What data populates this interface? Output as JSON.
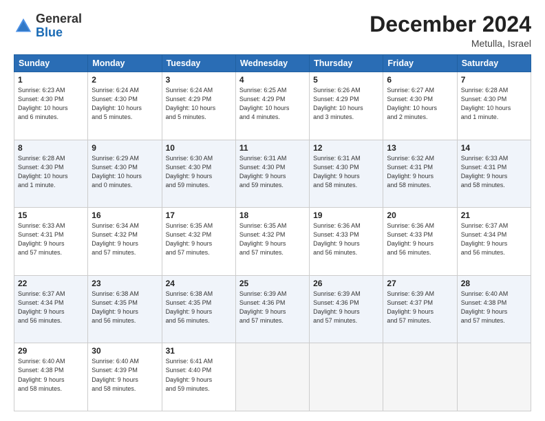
{
  "header": {
    "logo_general": "General",
    "logo_blue": "Blue",
    "month_title": "December 2024",
    "location": "Metulla, Israel"
  },
  "days_of_week": [
    "Sunday",
    "Monday",
    "Tuesday",
    "Wednesday",
    "Thursday",
    "Friday",
    "Saturday"
  ],
  "weeks": [
    [
      {
        "day": 1,
        "sunrise": "6:23 AM",
        "sunset": "4:30 PM",
        "daylight": "10 hours and 6 minutes."
      },
      {
        "day": 2,
        "sunrise": "6:24 AM",
        "sunset": "4:30 PM",
        "daylight": "10 hours and 5 minutes."
      },
      {
        "day": 3,
        "sunrise": "6:24 AM",
        "sunset": "4:29 PM",
        "daylight": "10 hours and 5 minutes."
      },
      {
        "day": 4,
        "sunrise": "6:25 AM",
        "sunset": "4:29 PM",
        "daylight": "10 hours and 4 minutes."
      },
      {
        "day": 5,
        "sunrise": "6:26 AM",
        "sunset": "4:29 PM",
        "daylight": "10 hours and 3 minutes."
      },
      {
        "day": 6,
        "sunrise": "6:27 AM",
        "sunset": "4:30 PM",
        "daylight": "10 hours and 2 minutes."
      },
      {
        "day": 7,
        "sunrise": "6:28 AM",
        "sunset": "4:30 PM",
        "daylight": "10 hours and 1 minute."
      }
    ],
    [
      {
        "day": 8,
        "sunrise": "6:28 AM",
        "sunset": "4:30 PM",
        "daylight": "10 hours and 1 minute."
      },
      {
        "day": 9,
        "sunrise": "6:29 AM",
        "sunset": "4:30 PM",
        "daylight": "10 hours and 0 minutes."
      },
      {
        "day": 10,
        "sunrise": "6:30 AM",
        "sunset": "4:30 PM",
        "daylight": "9 hours and 59 minutes."
      },
      {
        "day": 11,
        "sunrise": "6:31 AM",
        "sunset": "4:30 PM",
        "daylight": "9 hours and 59 minutes."
      },
      {
        "day": 12,
        "sunrise": "6:31 AM",
        "sunset": "4:30 PM",
        "daylight": "9 hours and 58 minutes."
      },
      {
        "day": 13,
        "sunrise": "6:32 AM",
        "sunset": "4:31 PM",
        "daylight": "9 hours and 58 minutes."
      },
      {
        "day": 14,
        "sunrise": "6:33 AM",
        "sunset": "4:31 PM",
        "daylight": "9 hours and 58 minutes."
      }
    ],
    [
      {
        "day": 15,
        "sunrise": "6:33 AM",
        "sunset": "4:31 PM",
        "daylight": "9 hours and 57 minutes."
      },
      {
        "day": 16,
        "sunrise": "6:34 AM",
        "sunset": "4:32 PM",
        "daylight": "9 hours and 57 minutes."
      },
      {
        "day": 17,
        "sunrise": "6:35 AM",
        "sunset": "4:32 PM",
        "daylight": "9 hours and 57 minutes."
      },
      {
        "day": 18,
        "sunrise": "6:35 AM",
        "sunset": "4:32 PM",
        "daylight": "9 hours and 57 minutes."
      },
      {
        "day": 19,
        "sunrise": "6:36 AM",
        "sunset": "4:33 PM",
        "daylight": "9 hours and 56 minutes."
      },
      {
        "day": 20,
        "sunrise": "6:36 AM",
        "sunset": "4:33 PM",
        "daylight": "9 hours and 56 minutes."
      },
      {
        "day": 21,
        "sunrise": "6:37 AM",
        "sunset": "4:34 PM",
        "daylight": "9 hours and 56 minutes."
      }
    ],
    [
      {
        "day": 22,
        "sunrise": "6:37 AM",
        "sunset": "4:34 PM",
        "daylight": "9 hours and 56 minutes."
      },
      {
        "day": 23,
        "sunrise": "6:38 AM",
        "sunset": "4:35 PM",
        "daylight": "9 hours and 56 minutes."
      },
      {
        "day": 24,
        "sunrise": "6:38 AM",
        "sunset": "4:35 PM",
        "daylight": "9 hours and 56 minutes."
      },
      {
        "day": 25,
        "sunrise": "6:39 AM",
        "sunset": "4:36 PM",
        "daylight": "9 hours and 57 minutes."
      },
      {
        "day": 26,
        "sunrise": "6:39 AM",
        "sunset": "4:36 PM",
        "daylight": "9 hours and 57 minutes."
      },
      {
        "day": 27,
        "sunrise": "6:39 AM",
        "sunset": "4:37 PM",
        "daylight": "9 hours and 57 minutes."
      },
      {
        "day": 28,
        "sunrise": "6:40 AM",
        "sunset": "4:38 PM",
        "daylight": "9 hours and 57 minutes."
      }
    ],
    [
      {
        "day": 29,
        "sunrise": "6:40 AM",
        "sunset": "4:38 PM",
        "daylight": "9 hours and 58 minutes."
      },
      {
        "day": 30,
        "sunrise": "6:40 AM",
        "sunset": "4:39 PM",
        "daylight": "9 hours and 58 minutes."
      },
      {
        "day": 31,
        "sunrise": "6:41 AM",
        "sunset": "4:40 PM",
        "daylight": "9 hours and 59 minutes."
      },
      null,
      null,
      null,
      null
    ]
  ]
}
